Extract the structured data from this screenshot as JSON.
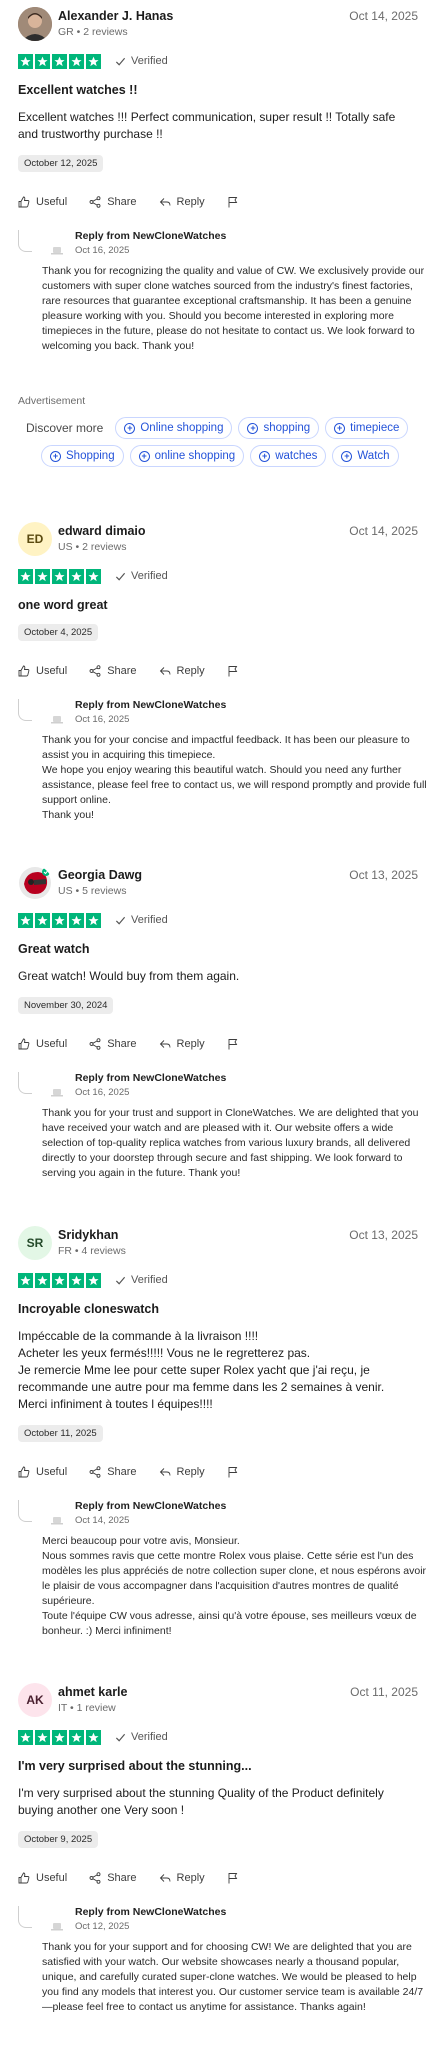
{
  "colors": {
    "star_green": "#00b67a",
    "link_blue": "#2453d9"
  },
  "labels": {
    "verified": "Verified",
    "useful": "Useful",
    "share": "Share",
    "reply": "Reply",
    "reply_from": "Reply from NewCloneWatches"
  },
  "reviews": [
    {
      "name": "Alexander J. Hanas",
      "meta": "GR • 2 reviews",
      "date": "Oct 14, 2025",
      "rating": 5,
      "title": "Excellent watches !!",
      "body": "Excellent watches !!! Perfect communication, super result !! Totally safe and trustworthy purchase !!",
      "experience_date": "October 12, 2025",
      "reply_date": "Oct 16, 2025",
      "reply_body": "Thank you for recognizing the quality and value of CW. We exclusively provide our customers with super clone watches sourced from the industry's finest factories, rare resources that guarantee exceptional craftsmanship. It has been a genuine pleasure working with you. Should you become interested in exploring more timepieces in the future, please do not hesitate to contact us. We look forward to welcoming you back. Thank you!"
    },
    {
      "name": "edward dimaio",
      "initials": "ED",
      "meta": "US • 2 reviews",
      "date": "Oct 14, 2025",
      "rating": 5,
      "title": "one word great",
      "experience_date": "October 4, 2025",
      "reply_date": "Oct 16, 2025",
      "reply_body": "Thank you for your concise and impactful feedback. It has been our pleasure to assist you in acquiring this timepiece.\nWe hope you enjoy wearing this beautiful watch. Should you need any further assistance, please feel free to contact us, we will respond promptly and provide full support online.\nThank you!"
    },
    {
      "name": "Georgia Dawg",
      "meta": "US • 5 reviews",
      "date": "Oct 13, 2025",
      "rating": 5,
      "title": "Great watch",
      "body": "Great watch! Would buy from them again.",
      "experience_date": "November 30, 2024",
      "reply_date": "Oct 16, 2025",
      "reply_body": "Thank you for your trust and support in CloneWatches. We are delighted that you have received your watch and are pleased with it. Our website offers a wide selection of top-quality replica watches from various luxury brands, all delivered directly to your doorstep through secure and fast shipping. We look forward to serving you again in the future. Thank you!"
    },
    {
      "name": "Sridykhan",
      "initials": "SR",
      "meta": "FR • 4 reviews",
      "date": "Oct 13, 2025",
      "rating": 5,
      "title": "Incroyable cloneswatch",
      "body": "Impéccable de la commande à la livraison !!!!\nAcheter les yeux fermés!!!!! Vous ne le regretterez pas.\nJe remercie Mme lee pour cette super Rolex yacht que j'ai reçu, je recommande une autre pour ma femme dans les 2 semaines à venir.\nMerci infiniment à toutes l équipes!!!!",
      "experience_date": "October 11, 2025",
      "reply_date": "Oct 14, 2025",
      "reply_body": "Merci beaucoup pour votre avis, Monsieur.\nNous sommes ravis que cette montre Rolex vous plaise. Cette série est l'un des modèles les plus appréciés de notre collection super clone, et nous espérons avoir le plaisir de vous accompagner dans l'acquisition d'autres montres de qualité supérieure.\nToute l'équipe CW vous adresse, ainsi qu'à votre épouse, ses meilleurs vœux de bonheur. :) Merci infiniment!"
    },
    {
      "name": "ahmet karle",
      "initials": "AK",
      "meta": "IT • 1 review",
      "date": "Oct 11, 2025",
      "rating": 5,
      "title": "I'm very surprised about the stunning...",
      "body": "I'm very surprised about the stunning Quality of the Product definitely buying another one Very soon !",
      "experience_date": "October 9, 2025",
      "reply_date": "Oct 12, 2025",
      "reply_body": "Thank you for your support and for choosing CW! We are delighted that you are satisfied with your watch. Our website showcases nearly a thousand popular, unique, and carefully curated super-clone watches. We would be pleased to help you find any models that interest you. Our customer service team is available 24/7—please feel free to contact us anytime for assistance. Thanks again!"
    }
  ],
  "advertisement": {
    "label": "Advertisement",
    "discover": "Discover more",
    "chips": [
      "Online shopping",
      "shopping",
      "timepiece",
      "Shopping",
      "online shopping",
      "watches",
      "Watch"
    ]
  }
}
